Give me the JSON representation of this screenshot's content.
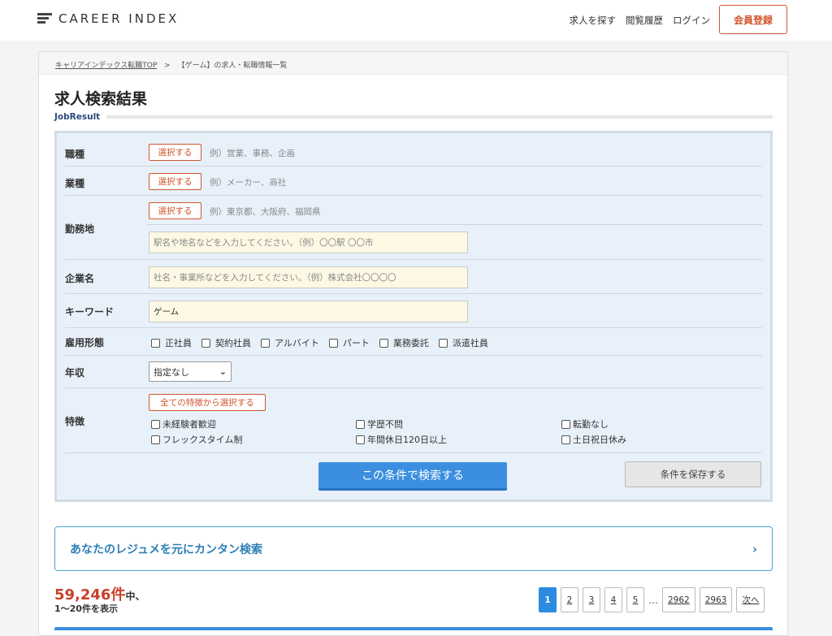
{
  "header": {
    "logo_text": "CAREER INDEX",
    "nav": [
      "求人を探す",
      "閲覧履歴",
      "ログイン"
    ],
    "register_label": "会員登録"
  },
  "breadcrumb": {
    "home": "キャリアインデックス転職TOP",
    "separator": ">",
    "current": "【ゲーム】の求人・転職情報一覧"
  },
  "page": {
    "title": "求人検索結果",
    "subtitle": "JobResult"
  },
  "search": {
    "select_label": "選択する",
    "job_type": {
      "label": "職種",
      "example": "例）営業、事務、企画"
    },
    "industry": {
      "label": "業種",
      "example": "例）メーカー、商社"
    },
    "location": {
      "label": "勤務地",
      "example": "例）東京都、大阪府、福岡県",
      "placeholder": "駅名や地名などを入力してください。（例）〇〇駅 〇〇市"
    },
    "company": {
      "label": "企業名",
      "placeholder": "社名・事業所などを入力してください。（例）株式会社〇〇〇〇"
    },
    "keyword": {
      "label": "キーワード",
      "value": "ゲーム"
    },
    "employment": {
      "label": "雇用形態",
      "options": [
        "正社員",
        "契約社員",
        "アルバイト",
        "パート",
        "業務委託",
        "派遣社員"
      ]
    },
    "salary": {
      "label": "年収",
      "value": "指定なし"
    },
    "features": {
      "label": "特徴",
      "select_all_label": "全ての特徴から選択する",
      "options": [
        "未経験者歓迎",
        "学歴不問",
        "転勤なし",
        "フレックスタイム制",
        "年間休日120日以上",
        "土日祝日休み"
      ]
    },
    "search_button": "この条件で検索する",
    "save_button": "条件を保存する"
  },
  "resume_search": {
    "label": "あなたのレジュメを元にカンタン検索",
    "arrow": "›"
  },
  "results": {
    "count": "59,246件",
    "count_suffix": "中、",
    "range": "1〜20件を表示"
  },
  "pagination": {
    "pages": [
      "1",
      "2",
      "3",
      "4",
      "5"
    ],
    "ellipsis": "…",
    "last_pages": [
      "2962",
      "2963"
    ],
    "next": "次へ",
    "active": "1"
  },
  "colors": {
    "accent": "#d0562e",
    "primary": "#3c8fe0",
    "link": "#2d7fb6",
    "count": "#c9412b"
  }
}
